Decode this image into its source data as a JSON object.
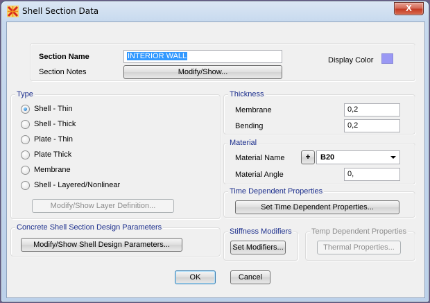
{
  "window": {
    "title": "Shell Section Data",
    "close_label": "X"
  },
  "section": {
    "name_label": "Section Name",
    "name_value": "INTERIOR WALL",
    "notes_label": "Section Notes",
    "notes_button": "Modify/Show...",
    "display_color_label": "Display Color",
    "display_color": "#9a98f4"
  },
  "type": {
    "legend": "Type",
    "options": [
      {
        "label": "Shell - Thin",
        "checked": true
      },
      {
        "label": "Shell - Thick",
        "checked": false
      },
      {
        "label": "Plate - Thin",
        "checked": false
      },
      {
        "label": "Plate Thick",
        "checked": false
      },
      {
        "label": "Membrane",
        "checked": false
      },
      {
        "label": "Shell - Layered/Nonlinear",
        "checked": false
      }
    ],
    "layer_button": "Modify/Show Layer Definition..."
  },
  "thickness": {
    "legend": "Thickness",
    "membrane_label": "Membrane",
    "membrane_value": "0,2",
    "bending_label": "Bending",
    "bending_value": "0,2"
  },
  "material": {
    "legend": "Material",
    "name_label": "Material Name",
    "plus_label": "+",
    "name_value": "B20",
    "angle_label": "Material Angle",
    "angle_value": "0,"
  },
  "time_dependent": {
    "legend": "Time Dependent Properties",
    "button": "Set Time Dependent Properties..."
  },
  "concrete": {
    "legend": "Concrete Shell Section Design Parameters",
    "button": "Modify/Show Shell Design Parameters..."
  },
  "stiffness": {
    "legend": "Stiffness Modifiers",
    "button": "Set Modifiers..."
  },
  "temp": {
    "legend": "Temp Dependent Properties",
    "button": "Thermal Properties..."
  },
  "footer": {
    "ok": "OK",
    "cancel": "Cancel"
  }
}
